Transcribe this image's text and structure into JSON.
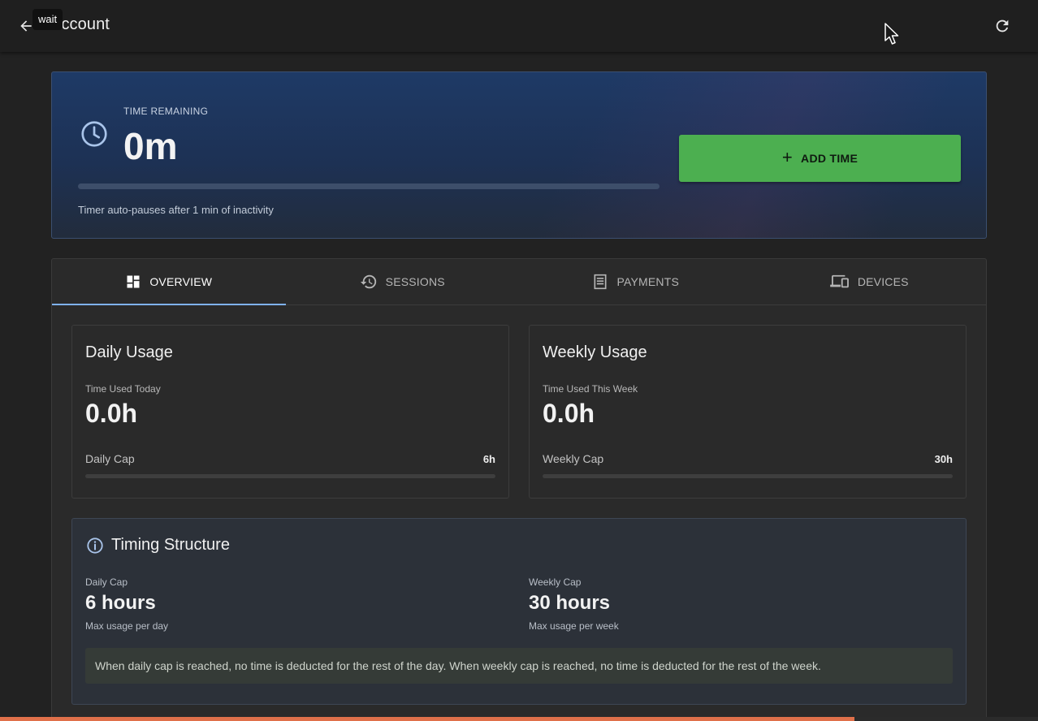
{
  "appbar": {
    "title": "Account",
    "tooltip": "wait",
    "back_icon": "arrow-left-icon",
    "refresh_icon": "refresh-icon"
  },
  "hero": {
    "label": "TIME REMAINING",
    "value": "0m",
    "progress_fraction": 0,
    "note": "Timer auto-pauses after 1 min of inactivity",
    "add_button": "ADD TIME",
    "icon": "clock-icon"
  },
  "tabs": [
    {
      "label": "OVERVIEW",
      "icon": "dashboard-icon",
      "active": true
    },
    {
      "label": "SESSIONS",
      "icon": "history-icon",
      "active": false
    },
    {
      "label": "PAYMENTS",
      "icon": "receipt-icon",
      "active": false
    },
    {
      "label": "DEVICES",
      "icon": "devices-icon",
      "active": false
    }
  ],
  "daily": {
    "title": "Daily Usage",
    "sub": "Time Used Today",
    "value": "0.0h",
    "cap_label": "Daily Cap",
    "cap_value": "6h",
    "used_fraction": 0
  },
  "weekly": {
    "title": "Weekly Usage",
    "sub": "Time Used This Week",
    "value": "0.0h",
    "cap_label": "Weekly Cap",
    "cap_value": "30h",
    "used_fraction": 0
  },
  "timing": {
    "title": "Timing Structure",
    "daily_label": "Daily Cap",
    "daily_value": "6 hours",
    "daily_sub": "Max usage per day",
    "weekly_label": "Weekly Cap",
    "weekly_value": "30 hours",
    "weekly_sub": "Max usage per week",
    "note": "When daily cap is reached, no time is deducted for the rest of the day. When weekly cap is reached, no time is deducted for the rest of the week."
  },
  "page_progress_fraction": 0.823,
  "colors": {
    "accent": "#7fb2f0",
    "add_button": "#4caf50",
    "bottom_progress": "#e0704a"
  }
}
